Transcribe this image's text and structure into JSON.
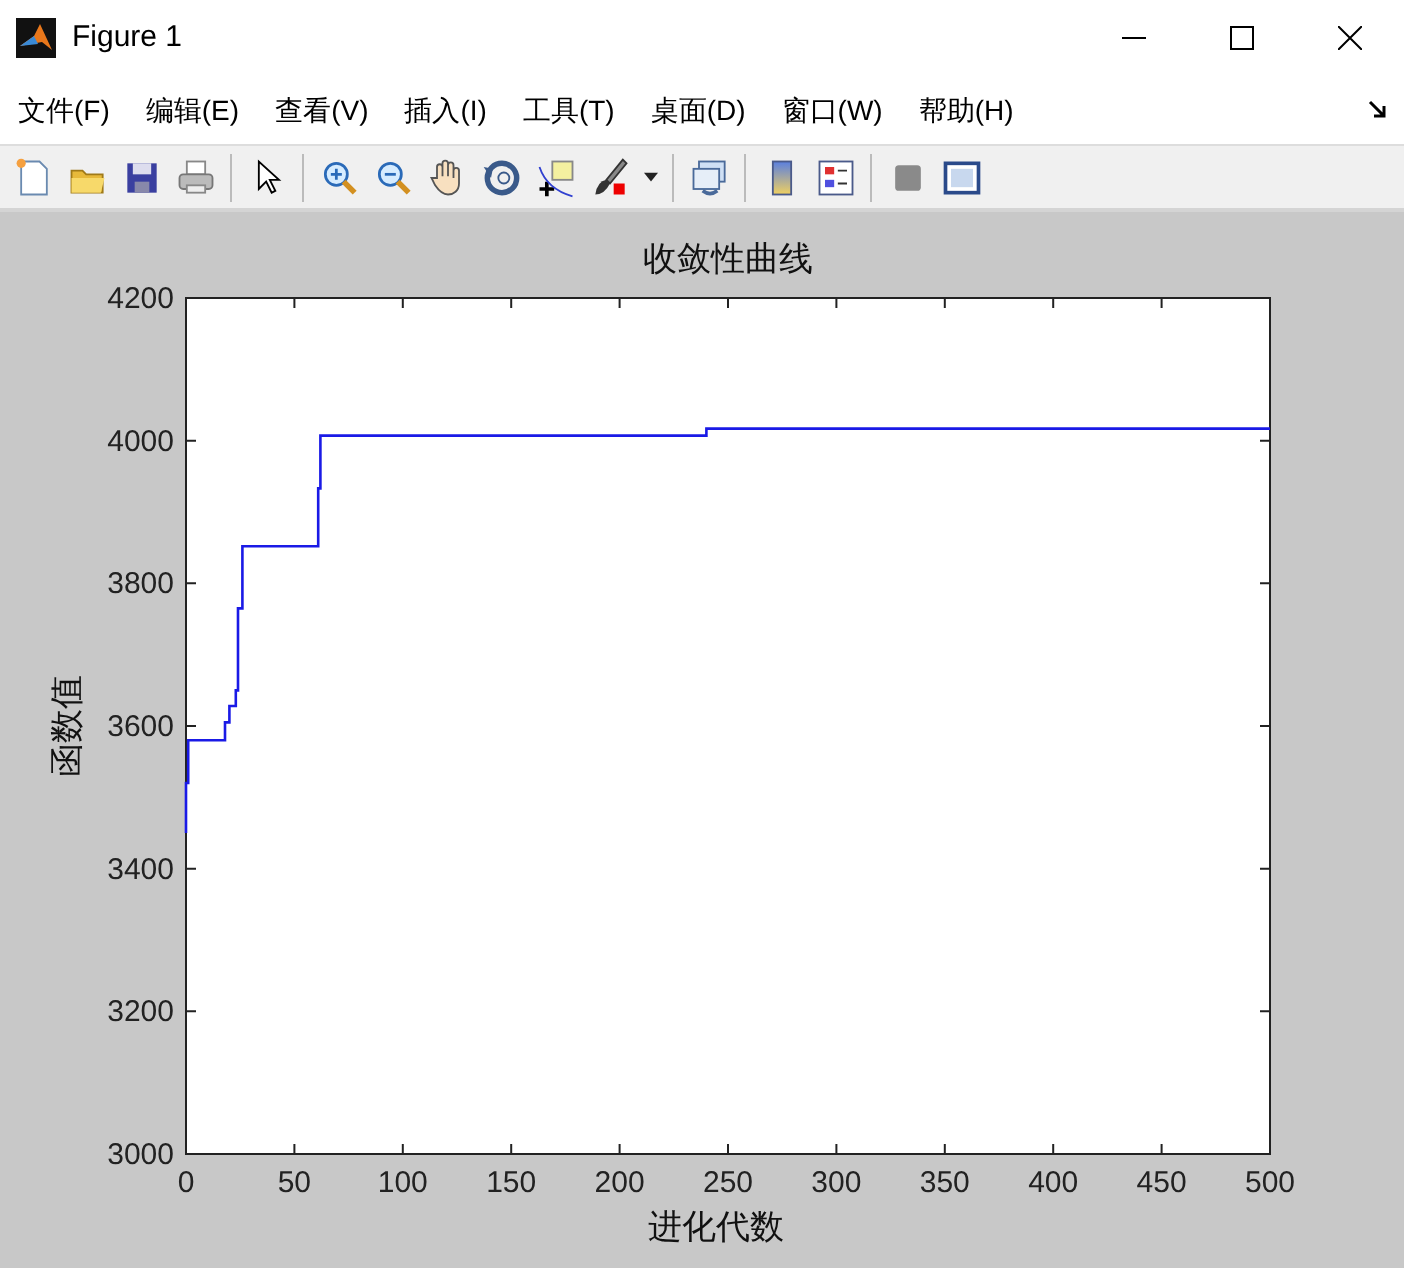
{
  "window": {
    "title": "Figure 1"
  },
  "menu": [
    {
      "label": "文件(F)"
    },
    {
      "label": "编辑(E)"
    },
    {
      "label": "查看(V)"
    },
    {
      "label": "插入(I)"
    },
    {
      "label": "工具(T)"
    },
    {
      "label": "桌面(D)"
    },
    {
      "label": "窗口(W)"
    },
    {
      "label": "帮助(H)"
    }
  ],
  "chart_data": {
    "type": "line",
    "title": "收敛性曲线",
    "xlabel": "进化代数",
    "ylabel": "函数值",
    "x": [
      0,
      0,
      1,
      1,
      18,
      18,
      20,
      20,
      23,
      23,
      24,
      24,
      26,
      26,
      61,
      61,
      62,
      62,
      240,
      240,
      500
    ],
    "series": [
      {
        "color": "#1a1ae6",
        "values": [
          3450,
          3520,
          3520,
          3580,
          3580,
          3605,
          3605,
          3628,
          3628,
          3650,
          3650,
          3765,
          3765,
          3852,
          3852,
          3933,
          3933,
          4007,
          4007,
          4017,
          4017
        ]
      }
    ],
    "xlim": [
      0,
      500
    ],
    "ylim": [
      3000,
      4200
    ],
    "xticks": [
      0,
      50,
      100,
      150,
      200,
      250,
      300,
      350,
      400,
      450,
      500
    ],
    "yticks": [
      3000,
      3200,
      3400,
      3600,
      3800,
      4000,
      4200
    ]
  }
}
